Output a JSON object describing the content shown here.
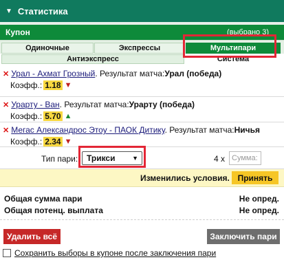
{
  "header": {
    "caret": "▼",
    "title": "Статистика"
  },
  "coupon": {
    "title": "Купон",
    "selected": "(выбрано 3)"
  },
  "tabs": [
    "Одиночные",
    "Экспрессы",
    "Мультипари"
  ],
  "subtabs": [
    "Антиэкспресс",
    "Система"
  ],
  "bets": [
    {
      "event": "Урал - Ахмат Грозный",
      "result_label": ". Результат матча:",
      "result": "Урал (победа)",
      "odds_label": "Коэфф.:",
      "odds": "1.18",
      "trend": "▼"
    },
    {
      "event": "Урарту - Ван",
      "result_label": ". Результат матча:",
      "result": "Урарту (победа)",
      "odds_label": "Коэфф.:",
      "odds": "5.70",
      "trend": "▲"
    },
    {
      "event": "Мегас Александрос Этоу - ПАОК Дитику",
      "result_label": ". Результат матча:",
      "result": "Ничья",
      "odds_label": "Коэфф.:",
      "odds": "2.34",
      "trend": "▼"
    }
  ],
  "bet_type": {
    "label": "Тип пари:",
    "value": "Трикси",
    "multiplier": "4 x",
    "amount_placeholder": "Сумма:"
  },
  "changed": {
    "message": "Изменились условия.",
    "accept": "Принять"
  },
  "totals": {
    "total_label": "Общая сумма пари",
    "total_value": "Не опред.",
    "payout_label": "Общая потенц. выплата",
    "payout_value": "Не опред."
  },
  "buttons": {
    "delete_all": "Удалить всё",
    "place_bet": "Заключить пари"
  },
  "save_option": "Сохранить выборы в купоне после заключения пари",
  "colors": {
    "header": "#107a5e",
    "accent_green": "#0e8a3a",
    "odds_bg": "#f8d840",
    "accept": "#f6c626",
    "delete": "#c62828",
    "highlight": "#e32636"
  }
}
